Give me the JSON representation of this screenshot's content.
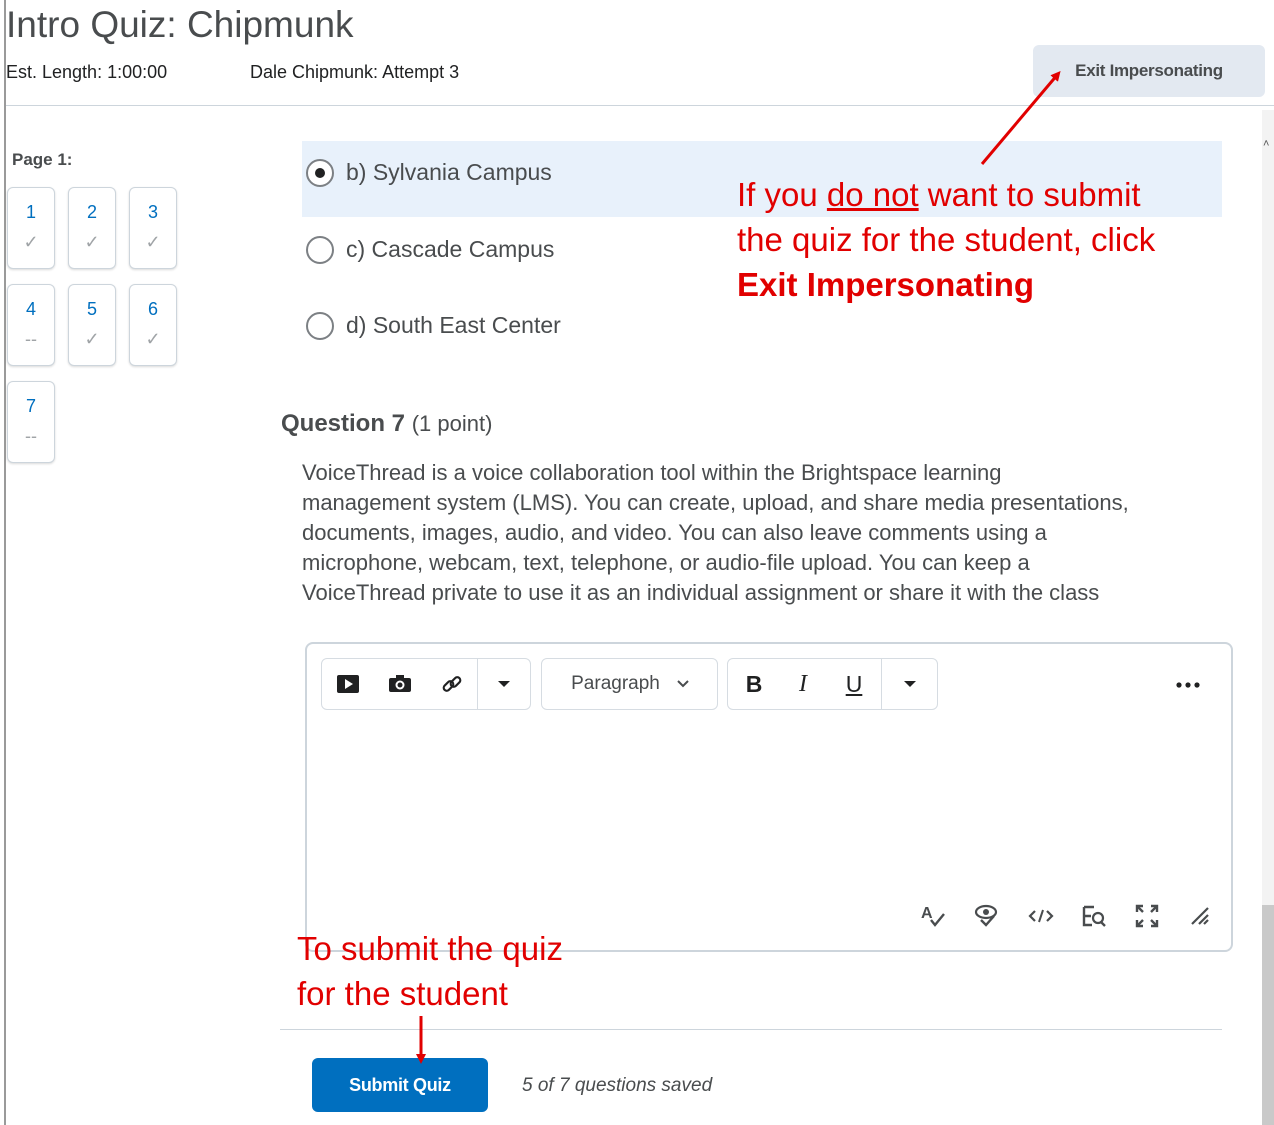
{
  "quiz": {
    "title": "Intro Quiz: Chipmunk",
    "est_length": "Est. Length: 1:00:00",
    "attempt": "Dale Chipmunk: Attempt 3",
    "exit_label": "Exit Impersonating"
  },
  "nav": {
    "page_label": "Page 1:",
    "questions": [
      {
        "num": "1",
        "status": "✓"
      },
      {
        "num": "2",
        "status": "✓"
      },
      {
        "num": "3",
        "status": "✓"
      },
      {
        "num": "4",
        "status": "--"
      },
      {
        "num": "5",
        "status": "✓"
      },
      {
        "num": "6",
        "status": "✓"
      },
      {
        "num": "7",
        "status": "--"
      }
    ]
  },
  "options": [
    {
      "label": "b) Sylvania Campus",
      "selected": true
    },
    {
      "label": "c) Cascade Campus",
      "selected": false
    },
    {
      "label": "d) South East Center",
      "selected": false
    }
  ],
  "question7": {
    "heading": "Question 7",
    "points": "(1 point)",
    "lines": [
      "VoiceThread is a voice collaboration tool within the Brightspace learning",
      "management system (LMS). You can create, upload, and share media presentations,",
      "documents, images, audio, and video. You can also leave comments using a",
      "microphone, webcam, text, telephone, or audio-file upload. You can keep a",
      "VoiceThread private to use it as an individual assignment or share it with the class"
    ]
  },
  "editor": {
    "format_select": "Paragraph",
    "bold": "B",
    "italic": "I",
    "underline": "U",
    "toolbar_icons": [
      "video-icon",
      "camera-icon",
      "link-icon",
      "dropdown-icon",
      "bold-icon",
      "italic-icon",
      "underline-icon",
      "more-icon"
    ],
    "bottom_icons": [
      "spellcheck-icon",
      "accessibility-check-icon",
      "source-code-icon",
      "find-replace-icon",
      "fullscreen-icon",
      "resize-icon"
    ]
  },
  "footer": {
    "submit_label": "Submit Quiz",
    "saved_status": "5 of 7 questions saved"
  },
  "annotations": {
    "exit_line1_pre": "If you ",
    "exit_line1_underline": "do not",
    "exit_line1_post": " want to submit",
    "exit_line2": "the quiz for the student, click",
    "exit_line3": "Exit Impersonating",
    "submit_line1": "To submit the quiz",
    "submit_line2": "for the student",
    "color": "#e10000"
  },
  "colors": {
    "accent": "#006fbf",
    "selected_bg": "#e8f1fb",
    "exit_button_bg": "#e3e9f1"
  }
}
